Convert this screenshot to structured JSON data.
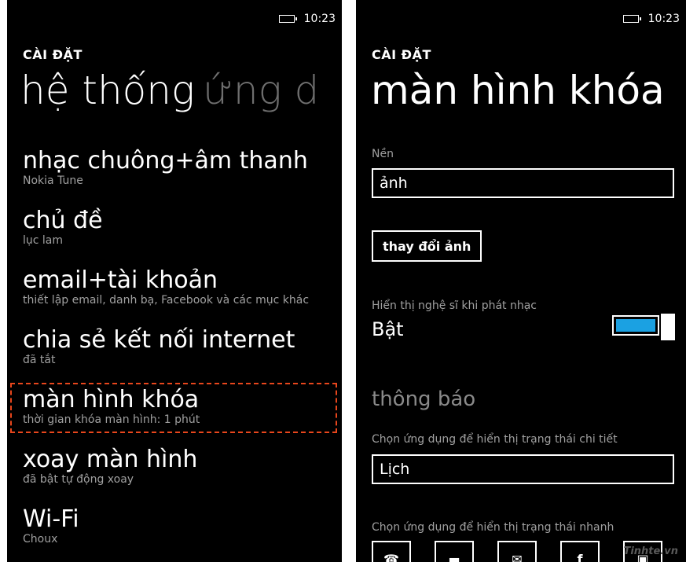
{
  "status_bar": {
    "time": "10:23"
  },
  "left": {
    "overline": "CÀI ĐẶT",
    "pivot": {
      "active": "hệ thống",
      "inactive": "ứng d"
    },
    "items": [
      {
        "title": "nhạc chuông+âm thanh",
        "subtitle": "Nokia Tune"
      },
      {
        "title": "chủ đề",
        "subtitle": "lục lam"
      },
      {
        "title": "email+tài khoản",
        "subtitle": "thiết lập email, danh bạ, Facebook và các mục khác"
      },
      {
        "title": "chia sẻ kết nối internet",
        "subtitle": "đã tắt"
      },
      {
        "title": "màn hình khóa",
        "subtitle": "thời gian khóa màn hình: 1 phút"
      },
      {
        "title": "xoay màn hình",
        "subtitle": "đã bật tự động xoay"
      },
      {
        "title": "Wi-Fi",
        "subtitle": "Choux"
      }
    ]
  },
  "right": {
    "overline": "CÀI ĐẶT",
    "title": "màn hình khóa",
    "background": {
      "label": "Nền",
      "value": "ảnh"
    },
    "change_photo_button": "thay đổi ảnh",
    "artist_toggle": {
      "label": "Hiển thị nghệ sĩ khi phát nhạc",
      "value": "Bật",
      "on": true
    },
    "notifications": {
      "section_title": "thông báo",
      "detail_label": "Chọn ứng dụng để hiển thị trạng thái chi tiết",
      "detail_value": "Lịch",
      "quick_label": "Chọn ứng dụng để hiển thị trạng thái nhanh",
      "quick_icons": [
        {
          "icon": "phone-icon",
          "glyph": "☎"
        },
        {
          "icon": "messaging-icon",
          "glyph": "▬"
        },
        {
          "icon": "mail-icon",
          "glyph": "✉"
        },
        {
          "icon": "facebook-icon",
          "glyph": "f"
        },
        {
          "icon": "calendar-icon",
          "glyph": "▣"
        }
      ]
    },
    "watermark": "Tinhte.vn"
  },
  "colors": {
    "accent": "#1ba1e2",
    "highlight": "#e8461c",
    "background": "#000000",
    "subtext": "#a0a0a0"
  }
}
